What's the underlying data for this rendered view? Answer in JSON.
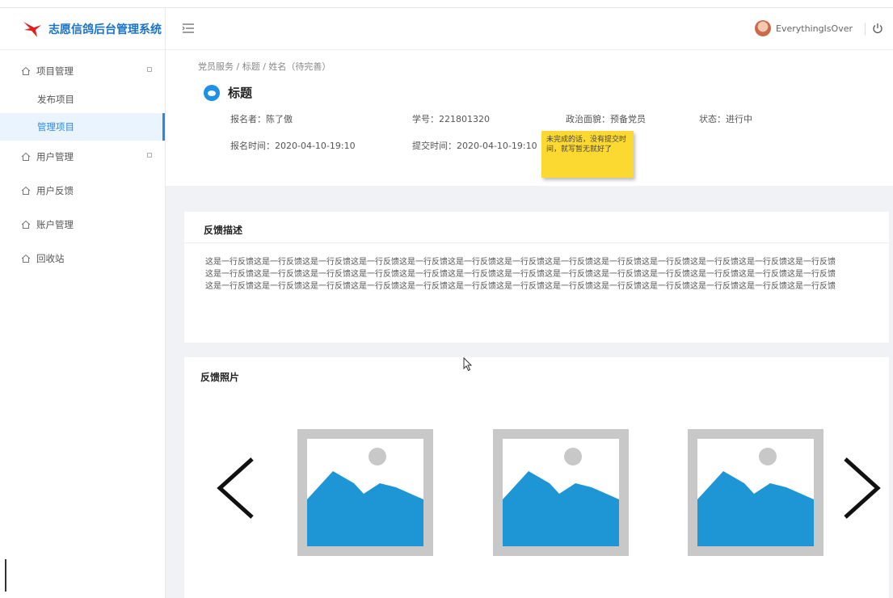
{
  "app": {
    "title": "志愿信鸽后台管理系统"
  },
  "sidebar": {
    "items": [
      {
        "label": "项目管理",
        "icon": "home-icon",
        "expandable": true
      },
      {
        "label": "发布项目",
        "sub": true
      },
      {
        "label": "管理项目",
        "sub": true,
        "active": true
      },
      {
        "label": "用户管理",
        "icon": "home-icon",
        "expandable": true
      },
      {
        "label": "用户反馈",
        "icon": "home-icon"
      },
      {
        "label": "账户管理",
        "icon": "home-icon"
      },
      {
        "label": "回收站",
        "icon": "home-icon"
      }
    ]
  },
  "header": {
    "username": "EverythingIsOver"
  },
  "breadcrumb": "党员服务 / 标题 / 姓名（待完善）",
  "detail": {
    "title": "标题",
    "reporter": "报名者：陈了傲",
    "student_id": "学号：221801320",
    "political": "政治面貌：预备党员",
    "status": "状态：进行中",
    "signup_time": "报名时间：2020-04-10-19:10",
    "submit_time": "提交时间：2020-04-10-19:10"
  },
  "sticky_note": "未完成的话，没有提交时间，就写暂无就好了",
  "feedback": {
    "title": "反馈描述",
    "lines": [
      "这是一行反馈这是一行反馈这是一行反馈这是一行反馈这是一行反馈这是一行反馈这是一行反馈这是一行反馈这是一行反馈这是一行反馈这是一行反馈这是一行反馈这是一行反馈",
      "这是一行反馈这是一行反馈这是一行反馈这是一行反馈这是一行反馈这是一行反馈这是一行反馈这是一行反馈这是一行反馈这是一行反馈这是一行反馈这是一行反馈这是一行反馈",
      "这是一行反馈这是一行反馈这是一行反馈这是一行反馈这是一行反馈这是一行反馈这是一行反馈这是一行反馈这是一行反馈这是一行反馈这是一行反馈这是一行反馈这是一行反馈"
    ]
  },
  "photos": {
    "title": "反馈照片",
    "items": [
      "image-placeholder-icon",
      "image-placeholder-icon",
      "image-placeholder-icon"
    ]
  },
  "colors": {
    "accent": "#2b8ae0",
    "logo": "#1a73c8",
    "note": "#fcd930",
    "photo_fill": "#1e96d6"
  }
}
